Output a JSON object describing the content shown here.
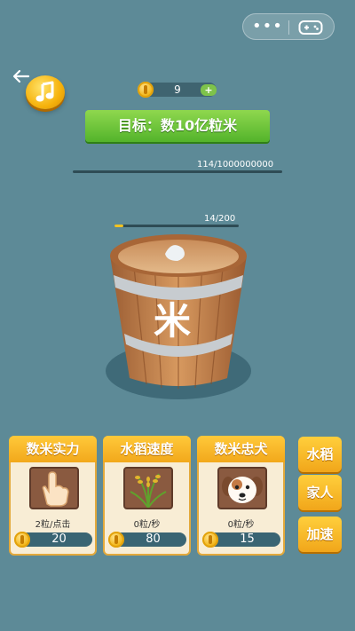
{
  "capsule": {
    "more_icon": "more-dots-icon",
    "game_icon": "gamepad-icon"
  },
  "top": {
    "back_icon": "back-arrow-icon",
    "music_icon": "music-note-icon",
    "coins": "9",
    "coin_add_label": "+"
  },
  "goal": {
    "text": "目标：数10亿粒米",
    "progress_text": "114/1000000000",
    "progress_fraction": 1.14e-07
  },
  "bucket": {
    "label": "米",
    "progress_text": "14/200",
    "progress_fraction": 0.07
  },
  "cards": [
    {
      "title": "数米实力",
      "icon": "hand-tap-icon",
      "rate": "2粒/点击",
      "cost": "20"
    },
    {
      "title": "水稻速度",
      "icon": "rice-plant-icon",
      "rate": "0粒/秒",
      "cost": "80"
    },
    {
      "title": "数米忠犬",
      "icon": "dog-face-icon",
      "rate": "0粒/秒",
      "cost": "15"
    }
  ],
  "side_buttons": [
    "水稻",
    "家人",
    "加速"
  ],
  "colors": {
    "background": "#5d8a97",
    "accent_gold": "#f2a81b",
    "banner_green": "#53b32b"
  }
}
